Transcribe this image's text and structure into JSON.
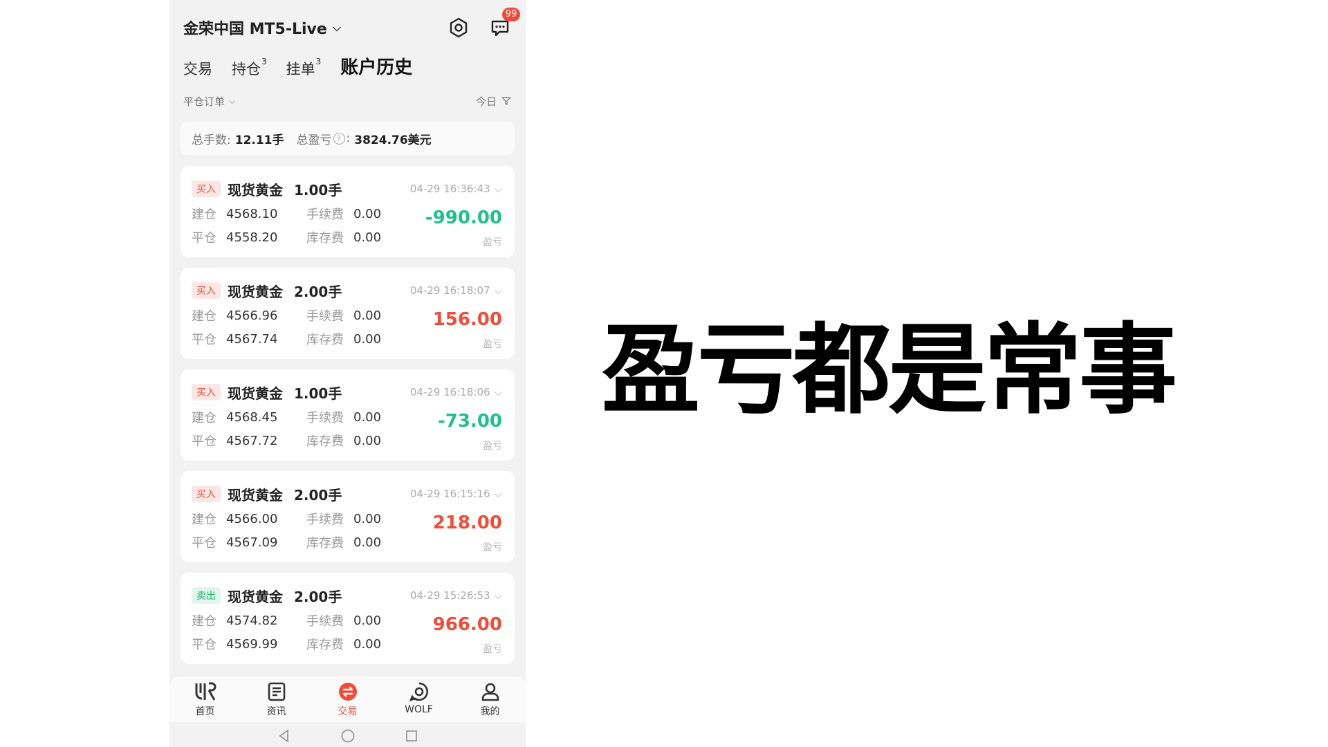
{
  "header": {
    "account": "金荣中国 MT5-Live",
    "badge": "99"
  },
  "tabs": [
    {
      "label": "交易",
      "sup": ""
    },
    {
      "label": "持仓",
      "sup": "3"
    },
    {
      "label": "挂单",
      "sup": "3"
    },
    {
      "label": "账户历史",
      "sup": ""
    }
  ],
  "filter": {
    "left": "平仓订单",
    "right": "今日"
  },
  "summary": {
    "lots_label": "总手数:",
    "lots_value": "12.11手",
    "pl_label": "总盈亏",
    "pl_value": "3824.76美元"
  },
  "labels": {
    "open": "建仓",
    "close": "平仓",
    "fee": "手续费",
    "swap": "库存费",
    "pl": "盈亏"
  },
  "orders": [
    {
      "side": "买入",
      "symbol": "现货黄金",
      "lots": "1.00手",
      "time": "04-29 16:36:43",
      "open": "4568.10",
      "close": "4558.20",
      "fee": "0.00",
      "swap": "0.00",
      "pl": "-990.00"
    },
    {
      "side": "买入",
      "symbol": "现货黄金",
      "lots": "2.00手",
      "time": "04-29 16:18:07",
      "open": "4566.96",
      "close": "4567.74",
      "fee": "0.00",
      "swap": "0.00",
      "pl": "156.00"
    },
    {
      "side": "买入",
      "symbol": "现货黄金",
      "lots": "1.00手",
      "time": "04-29 16:18:06",
      "open": "4568.45",
      "close": "4567.72",
      "fee": "0.00",
      "swap": "0.00",
      "pl": "-73.00"
    },
    {
      "side": "买入",
      "symbol": "现货黄金",
      "lots": "2.00手",
      "time": "04-29 16:15:16",
      "open": "4566.00",
      "close": "4567.09",
      "fee": "0.00",
      "swap": "0.00",
      "pl": "218.00"
    },
    {
      "side": "卖出",
      "symbol": "现货黄金",
      "lots": "2.00手",
      "time": "04-29 15:26:53",
      "open": "4574.82",
      "close": "4569.99",
      "fee": "0.00",
      "swap": "0.00",
      "pl": "966.00"
    }
  ],
  "nav": [
    {
      "label": "首页",
      "icon": "home-logo-icon"
    },
    {
      "label": "资讯",
      "icon": "news-icon"
    },
    {
      "label": "交易",
      "icon": "trade-icon"
    },
    {
      "label": "WOLF",
      "icon": "wolf-icon"
    },
    {
      "label": "我的",
      "icon": "profile-icon"
    }
  ],
  "headline": "盈亏都是常事",
  "colors": {
    "profit": "#ef4d3a",
    "loss": "#1fc08a",
    "badge": "#f04a3e"
  }
}
